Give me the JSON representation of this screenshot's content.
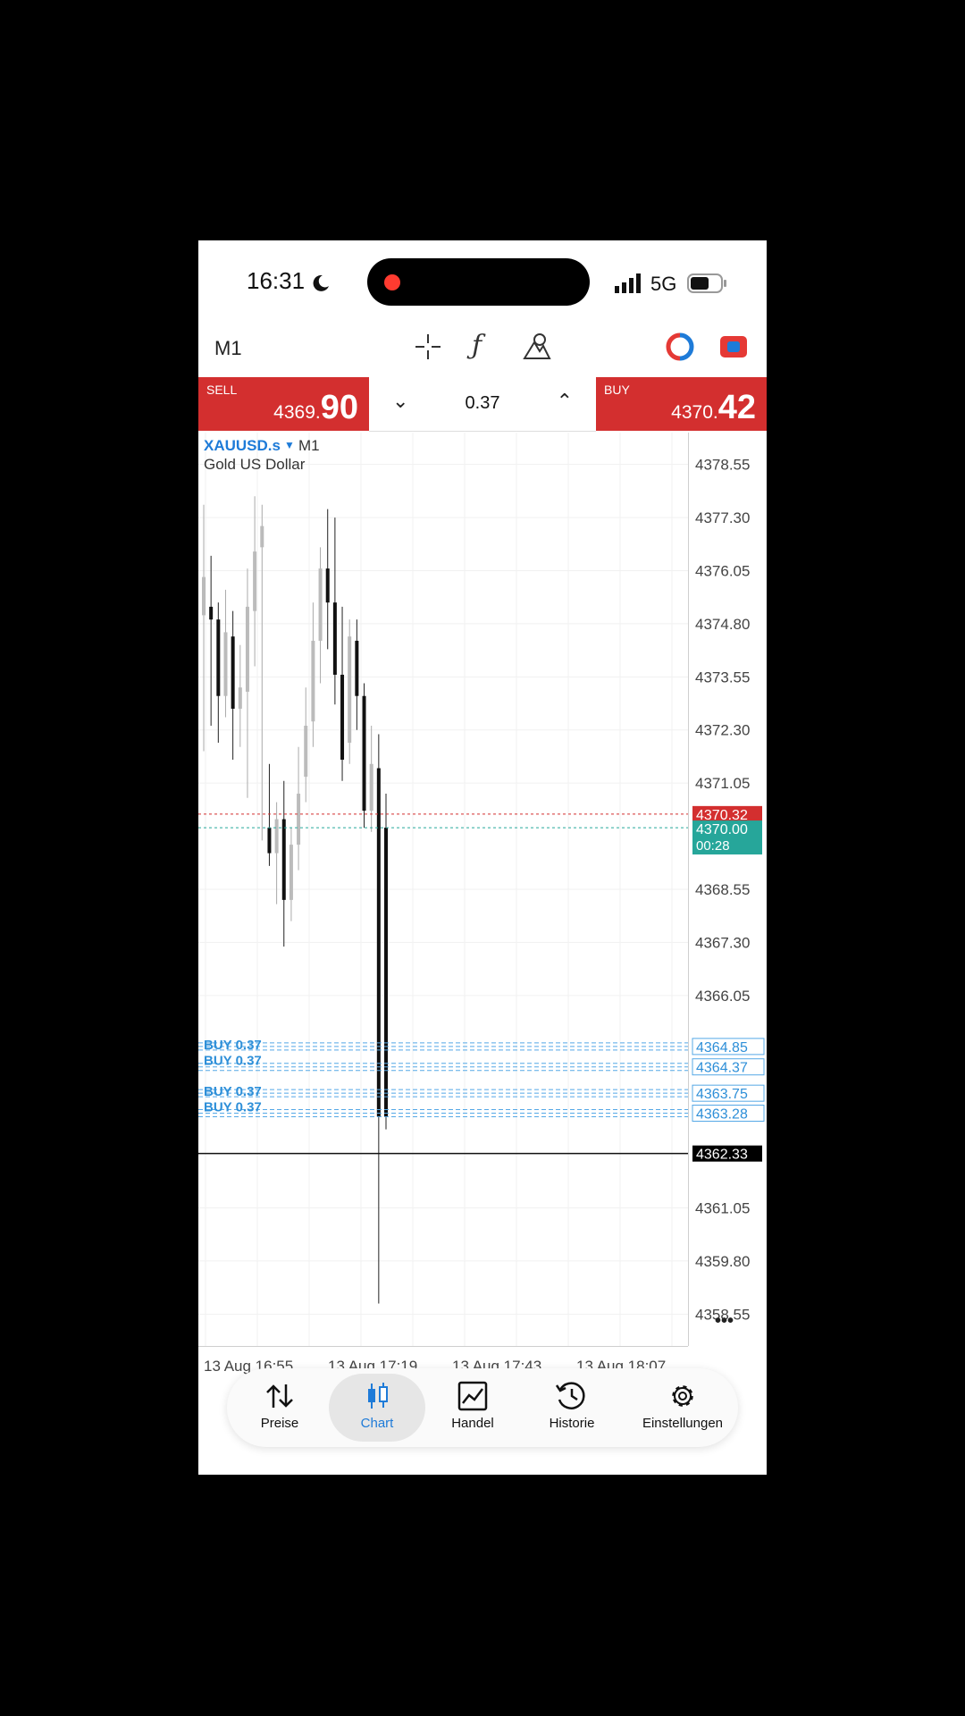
{
  "status_bar": {
    "time": "16:31",
    "network": "5G"
  },
  "toolbar": {
    "timeframe": "M1",
    "icons": [
      "crosshair-icon",
      "function-icon",
      "objects-icon",
      "trade-toggle-icon",
      "account-icon"
    ]
  },
  "trade_bar": {
    "sell": {
      "label": "SELL",
      "price_small": "4369.",
      "price_big": "90"
    },
    "volume": "0.37",
    "buy": {
      "label": "BUY",
      "price_small": "4370.",
      "price_big": "42"
    }
  },
  "chart_header": {
    "symbol": "XAUUSD.s",
    "timeframe": "M1",
    "description": "Gold US Dollar"
  },
  "chart_data": {
    "type": "candlestick",
    "y_ticks": [
      "4378.55",
      "4377.30",
      "4376.05",
      "4374.80",
      "4373.55",
      "4372.30",
      "4371.05",
      "4368.55",
      "4367.30",
      "4366.05",
      "4361.05",
      "4359.80",
      "4358.55"
    ],
    "y_range": [
      4357.8,
      4379.3
    ],
    "x_ticks": [
      "13 Aug 16:55",
      "13 Aug 17:19",
      "13 Aug 17:43",
      "13 Aug 18:07"
    ],
    "ask_line": {
      "label": "4370.32",
      "value": 4370.32,
      "color": "#d32f2f"
    },
    "bid_line": {
      "label": "4370.00",
      "value": 4370.0,
      "countdown": "00:28",
      "color": "#26a69a"
    },
    "current_line": {
      "label": "4362.33",
      "value": 4362.33
    },
    "position_labels": [
      "4364.85",
      "4364.37",
      "4363.75",
      "4363.28"
    ],
    "position_text": "BUY 0.37",
    "candles": [
      {
        "o": 4375.0,
        "h": 4377.6,
        "l": 4371.8,
        "c": 4375.9
      },
      {
        "o": 4375.2,
        "h": 4376.4,
        "l": 4372.4,
        "c": 4374.9
      },
      {
        "o": 4374.9,
        "h": 4375.3,
        "l": 4372.0,
        "c": 4373.1
      },
      {
        "o": 4373.1,
        "h": 4375.6,
        "l": 4372.6,
        "c": 4374.6
      },
      {
        "o": 4374.5,
        "h": 4375.1,
        "l": 4371.6,
        "c": 4372.8
      },
      {
        "o": 4372.8,
        "h": 4374.3,
        "l": 4371.9,
        "c": 4373.3
      },
      {
        "o": 4373.2,
        "h": 4376.1,
        "l": 4370.7,
        "c": 4375.2
      },
      {
        "o": 4375.1,
        "h": 4377.8,
        "l": 4373.8,
        "c": 4376.5
      },
      {
        "o": 4376.6,
        "h": 4377.6,
        "l": 4369.7,
        "c": 4377.1
      },
      {
        "o": 4370.0,
        "h": 4371.5,
        "l": 4369.1,
        "c": 4369.4
      },
      {
        "o": 4369.4,
        "h": 4370.6,
        "l": 4368.2,
        "c": 4370.2
      },
      {
        "o": 4370.2,
        "h": 4371.1,
        "l": 4367.2,
        "c": 4368.3
      },
      {
        "o": 4368.3,
        "h": 4370.0,
        "l": 4367.8,
        "c": 4369.6
      },
      {
        "o": 4369.6,
        "h": 4371.9,
        "l": 4369.0,
        "c": 4370.8
      },
      {
        "o": 4371.2,
        "h": 4373.3,
        "l": 4370.6,
        "c": 4372.4
      },
      {
        "o": 4372.5,
        "h": 4375.3,
        "l": 4371.9,
        "c": 4374.4
      },
      {
        "o": 4374.4,
        "h": 4376.6,
        "l": 4373.4,
        "c": 4376.1
      },
      {
        "o": 4376.1,
        "h": 4377.5,
        "l": 4374.2,
        "c": 4375.3
      },
      {
        "o": 4375.3,
        "h": 4377.3,
        "l": 4372.9,
        "c": 4373.6
      },
      {
        "o": 4373.6,
        "h": 4375.2,
        "l": 4371.1,
        "c": 4371.6
      },
      {
        "o": 4372.0,
        "h": 4374.9,
        "l": 4371.5,
        "c": 4374.5
      },
      {
        "o": 4374.4,
        "h": 4374.9,
        "l": 4372.3,
        "c": 4373.1
      },
      {
        "o": 4373.1,
        "h": 4373.4,
        "l": 4370.0,
        "c": 4370.4
      },
      {
        "o": 4370.4,
        "h": 4372.4,
        "l": 4369.9,
        "c": 4371.5
      },
      {
        "o": 4371.4,
        "h": 4372.2,
        "l": 4358.8,
        "c": 4363.2
      },
      {
        "o": 4370.0,
        "h": 4370.8,
        "l": 4362.9,
        "c": 4363.2
      }
    ]
  },
  "bottom_nav": [
    {
      "label": "Preise"
    },
    {
      "label": "Chart"
    },
    {
      "label": "Handel"
    },
    {
      "label": "Historie"
    },
    {
      "label": "Einstellungen"
    }
  ],
  "more_menu": "•••",
  "colors": {
    "sell_red": "#d32f2f",
    "accent_blue": "#1e7bd8",
    "bid_green": "#26a69a"
  }
}
